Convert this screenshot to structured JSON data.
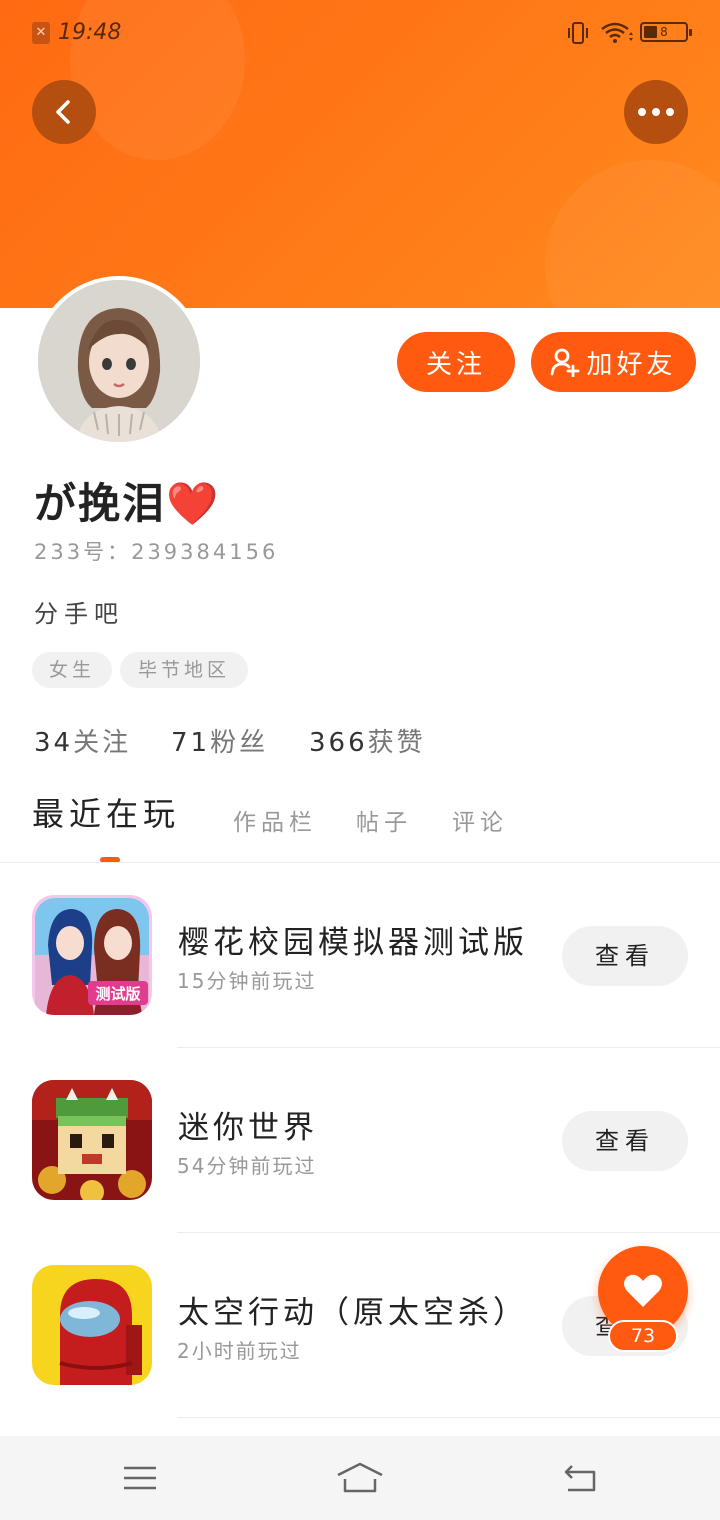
{
  "status_bar": {
    "time": "19:48",
    "battery": "8"
  },
  "header": {
    "back_icon": "chevron-left-icon",
    "more_icon": "more-horizontal-icon",
    "accent": "#ff6a12"
  },
  "profile": {
    "username": "が挽泪❤️",
    "uid": "233号：239384156",
    "bio": "分手吧",
    "tags": [
      "女生",
      "毕节地区"
    ],
    "follow_label": "关注",
    "add_friend_label": "加好友",
    "stats": [
      {
        "num": "34",
        "label": "关注"
      },
      {
        "num": "71",
        "label": "粉丝"
      },
      {
        "num": "366",
        "label": "获赞"
      }
    ]
  },
  "tabs": [
    "最近在玩",
    "作品栏",
    "帖子",
    "评论"
  ],
  "games": [
    {
      "title": "樱花校园模拟器测试版",
      "time": "15分钟前玩过",
      "action": "查看",
      "icon_badge": "测试版"
    },
    {
      "title": "迷你世界",
      "time": "54分钟前玩过",
      "action": "查看"
    },
    {
      "title": "太空行动（原太空杀）",
      "time": "2小时前玩过",
      "action": "查看"
    }
  ],
  "like": {
    "count": "73"
  },
  "nav": {
    "menu_icon": "menu-icon",
    "home_icon": "home-icon",
    "back_icon": "back-icon"
  }
}
